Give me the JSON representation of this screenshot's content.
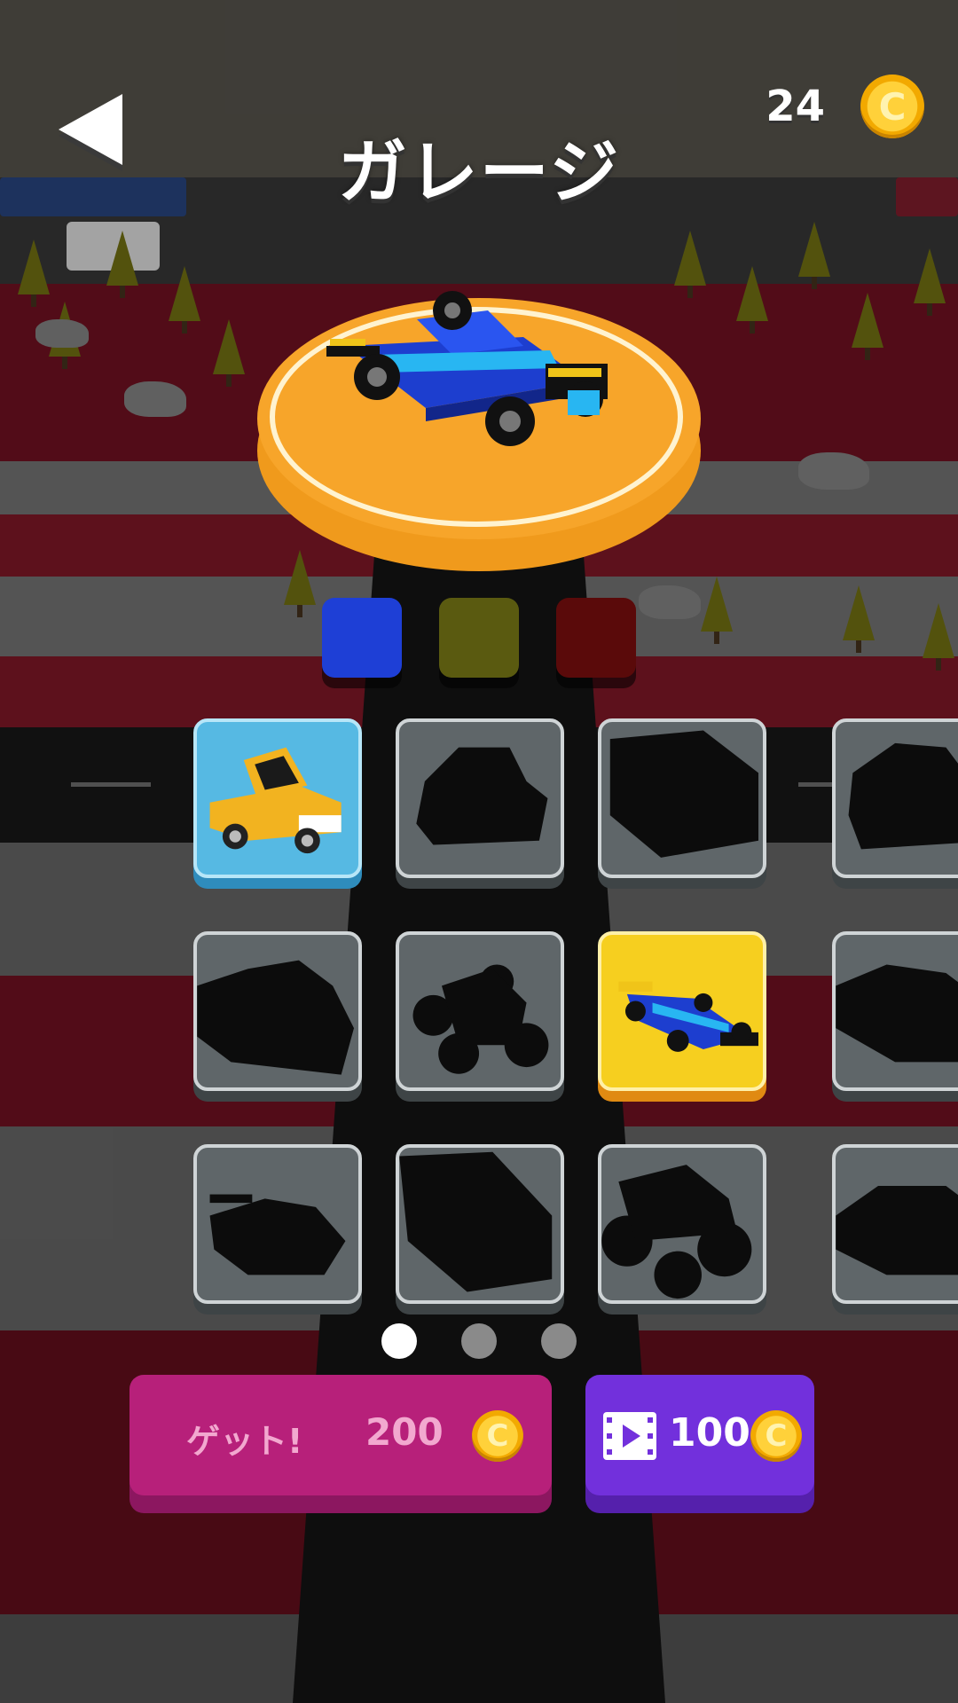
{
  "header": {
    "title": "ガレージ",
    "coins": "24",
    "coin_symbol": "C"
  },
  "colors": {
    "swatches": [
      "#1e3fd6",
      "#5a5a10",
      "#5a0a0a"
    ],
    "accent_get": "#b7207a",
    "accent_video": "#7230dc"
  },
  "garage": {
    "cells": [
      {
        "name": "yellow-pickup",
        "state": "owned"
      },
      {
        "name": "mystery-vehicle",
        "state": "locked"
      },
      {
        "name": "mystery-van",
        "state": "locked"
      },
      {
        "name": "mystery-jeep",
        "state": "locked"
      },
      {
        "name": "mystery-semi-truck",
        "state": "locked"
      },
      {
        "name": "mystery-buggy",
        "state": "locked"
      },
      {
        "name": "blue-formula-car",
        "state": "selected"
      },
      {
        "name": "mystery-sports-car",
        "state": "locked"
      },
      {
        "name": "mystery-race-car",
        "state": "locked"
      },
      {
        "name": "mystery-box-truck",
        "state": "locked"
      },
      {
        "name": "mystery-monster-truck",
        "state": "locked"
      },
      {
        "name": "mystery-coupe",
        "state": "locked"
      }
    ],
    "page": 1,
    "page_count": 3
  },
  "actions": {
    "get_label": "ゲット!",
    "get_price": "200",
    "video_price": "100",
    "coin_symbol": "C"
  }
}
